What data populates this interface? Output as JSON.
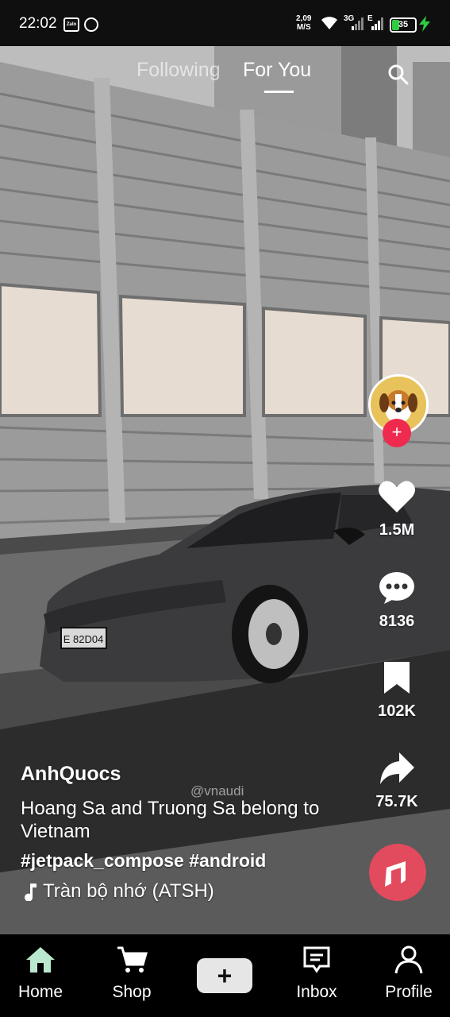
{
  "status_bar": {
    "time": "22:02",
    "notif_icon_1": "zalo-icon",
    "notif_icon_1_text": "Zalo",
    "notif_icon_2": "messenger-icon",
    "net_speed_value": "2,09",
    "net_speed_unit": "M/S",
    "network_1": "3G",
    "network_2": "E",
    "battery_level": "35",
    "charging": true
  },
  "top_tabs": {
    "following": "Following",
    "for_you": "For You",
    "active": "For You"
  },
  "actions": {
    "likes": "1.5M",
    "comments": "8136",
    "bookmarks": "102K",
    "shares": "75.7K",
    "follow_symbol": "+"
  },
  "post": {
    "username": "AnhQuocs",
    "description": "Hoang Sa and Truong Sa belong to Vietnam",
    "hashtags": "#jetpack_compose #android",
    "sound": "Tràn bộ nhớ (ATSH)",
    "watermark": "@vnaudi",
    "plate": "E 82D04"
  },
  "bottom_nav": {
    "home": "Home",
    "shop": "Shop",
    "create": "+",
    "inbox": "Inbox",
    "profile": "Profile"
  },
  "colors": {
    "accent_red": "#ee2a4f",
    "disc_red": "#e24a5e",
    "home_icon": "#b9e8cf",
    "battery_green": "#2ecc40"
  }
}
